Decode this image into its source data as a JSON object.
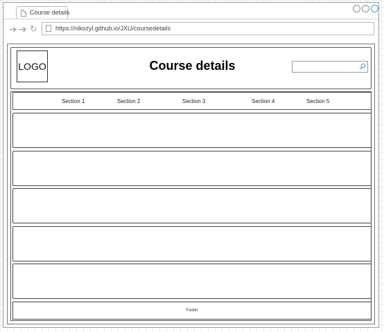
{
  "browser": {
    "tab_title": "Course details",
    "url": "https://nikozyl.github.io/JXU/coursedetails"
  },
  "header": {
    "logo_text": "LOGO",
    "title": "Course details",
    "search_value": ""
  },
  "nav": {
    "sections": [
      "Section 1",
      "Section 2",
      "Section 3",
      "Section 4",
      "Section 5"
    ]
  },
  "footer": {
    "text": "Footer"
  },
  "icons": {
    "back": "arrow-left-icon",
    "forward": "arrow-right-icon",
    "reload": "reload-icon",
    "search": "search-icon"
  },
  "colors": {
    "accent": "#3d9bd6"
  }
}
